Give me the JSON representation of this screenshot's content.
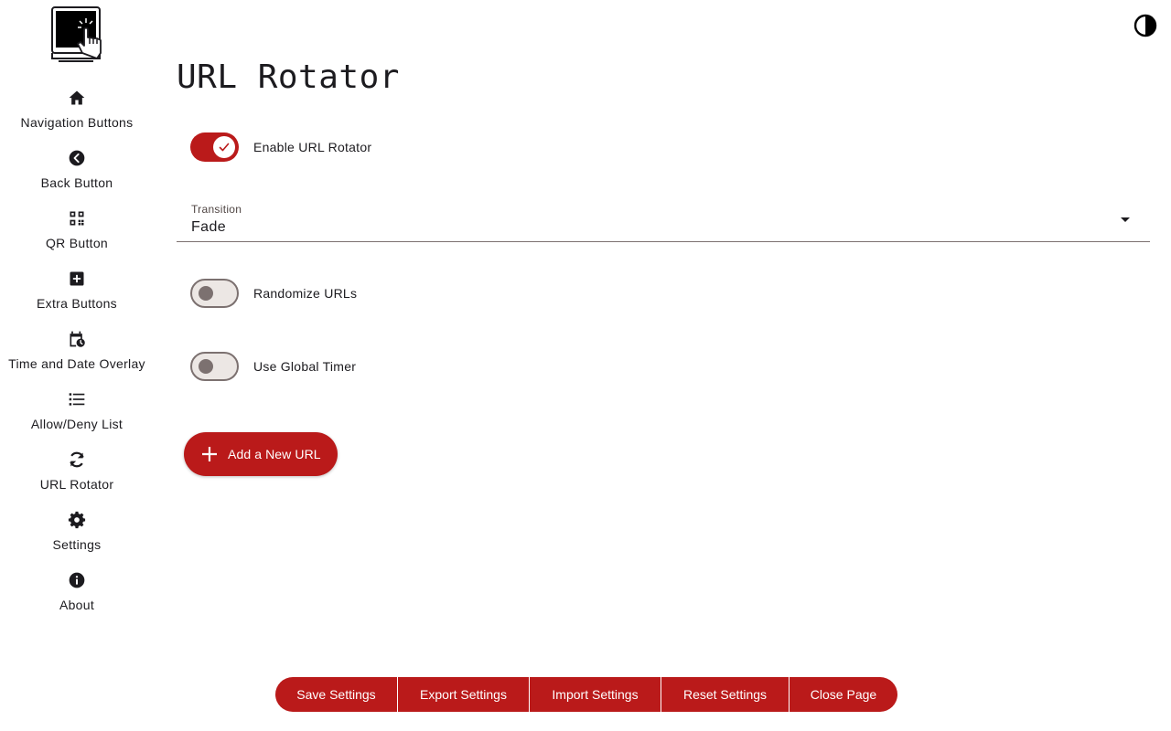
{
  "app": {
    "logo_icon": "touchscreen-kiosk-icon",
    "theme_toggle_icon": "contrast-icon"
  },
  "colors": {
    "accent": "#ba1a1a",
    "text": "#1c1b1f",
    "outline": "#7c7170"
  },
  "sidebar": {
    "items": [
      {
        "label": "Navigation Buttons",
        "icon": "home-icon"
      },
      {
        "label": "Back Button",
        "icon": "back-circle-icon"
      },
      {
        "label": "QR Button",
        "icon": "qr-code-icon"
      },
      {
        "label": "Extra Buttons",
        "icon": "plus-square-icon"
      },
      {
        "label": "Time and Date Overlay",
        "icon": "calendar-clock-icon"
      },
      {
        "label": "Allow/Deny List",
        "icon": "list-icon"
      },
      {
        "label": "URL Rotator",
        "icon": "sync-icon"
      },
      {
        "label": "Settings",
        "icon": "gear-icon"
      },
      {
        "label": "About",
        "icon": "info-icon"
      }
    ]
  },
  "main": {
    "title": "URL Rotator",
    "enable_switch": {
      "label": "Enable URL Rotator",
      "checked": true
    },
    "transition": {
      "label": "Transition",
      "value": "Fade"
    },
    "randomize_switch": {
      "label": "Randomize URLs",
      "checked": false
    },
    "global_timer_switch": {
      "label": "Use Global Timer",
      "checked": false
    },
    "add_button": {
      "label": "Add a New URL",
      "icon": "plus-icon"
    }
  },
  "bottom_bar": {
    "save": "Save Settings",
    "export": "Export Settings",
    "import": "Import Settings",
    "reset": "Reset Settings",
    "close": "Close Page"
  }
}
